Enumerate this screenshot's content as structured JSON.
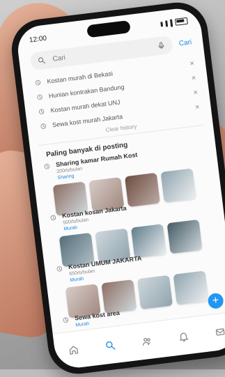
{
  "status": {
    "time": "12:00"
  },
  "search": {
    "placeholder": "Cari",
    "cancel_label": "Cari"
  },
  "recent_searches": {
    "items": [
      "Kostan murah di Bekasi",
      "Hunian kontrakan Bandung",
      "Kostan murah dekat UNJ",
      "Sewa kost murah Jakarta"
    ],
    "clear_label": "Clear history"
  },
  "section": {
    "title": "Paling banyak di posting"
  },
  "listings": [
    {
      "title": "Sharing kamar Rumah Kost",
      "subtitle": "200rb/bulan",
      "link_text": "Sharing"
    },
    {
      "title": "Kostan kosan Jakarta",
      "subtitle": "500rb/bulan",
      "link_text": "Murah"
    },
    {
      "title": "Kostan UMUM JAKARTA",
      "subtitle": "650rb/bulan",
      "link_text": "Murah"
    },
    {
      "title": "Sewa kost area",
      "subtitle": "",
      "link_text": "Murah"
    }
  ],
  "icons": {
    "search": "search-icon",
    "mic": "mic-icon",
    "history": "history-icon",
    "close": "close-icon",
    "home": "home-icon",
    "explore": "search-icon",
    "people": "people-icon",
    "notifications": "bell-icon",
    "messages": "mail-icon",
    "add": "plus-icon"
  },
  "colors": {
    "accent": "#1e88e5",
    "fab": "#2196f3"
  }
}
